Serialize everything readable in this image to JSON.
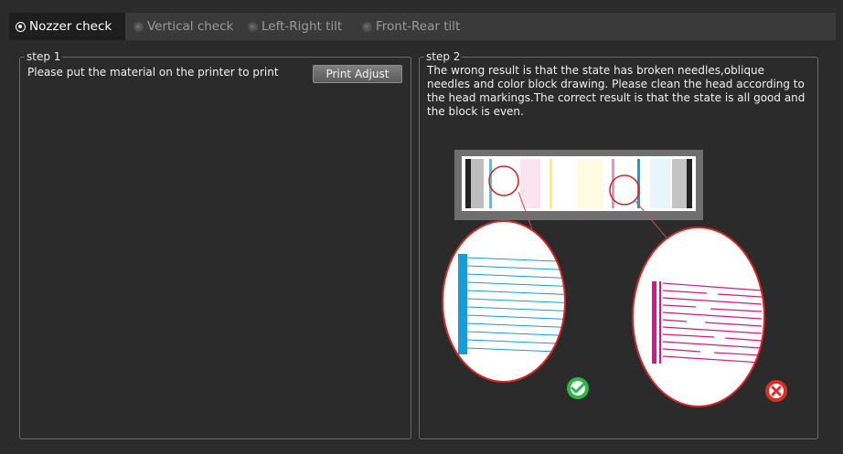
{
  "tabs": [
    {
      "label": "Nozzer check",
      "active": true
    },
    {
      "label": "Vertical check",
      "active": false
    },
    {
      "label": "Left-Right tilt",
      "active": false
    },
    {
      "label": "Front-Rear tilt",
      "active": false
    }
  ],
  "step1": {
    "title": "step 1",
    "instruction": "Please put the material on the printer to print",
    "button_label": "Print Adjust"
  },
  "step2": {
    "title": "step 2",
    "description": "The wrong result is that the state has broken needles,oblique needles and color block drawing. Please clean the head according to the head markings.The correct result is that the state is all good and the block is even.",
    "diagram": {
      "good_icon": "check-circle-icon",
      "bad_icon": "x-circle-icon",
      "colors": {
        "good": "#2eb84a",
        "bad": "#d93025",
        "cyan": "#1a9ad6",
        "magenta": "#d6178a",
        "circle_outline": "#d02a2a"
      }
    }
  }
}
